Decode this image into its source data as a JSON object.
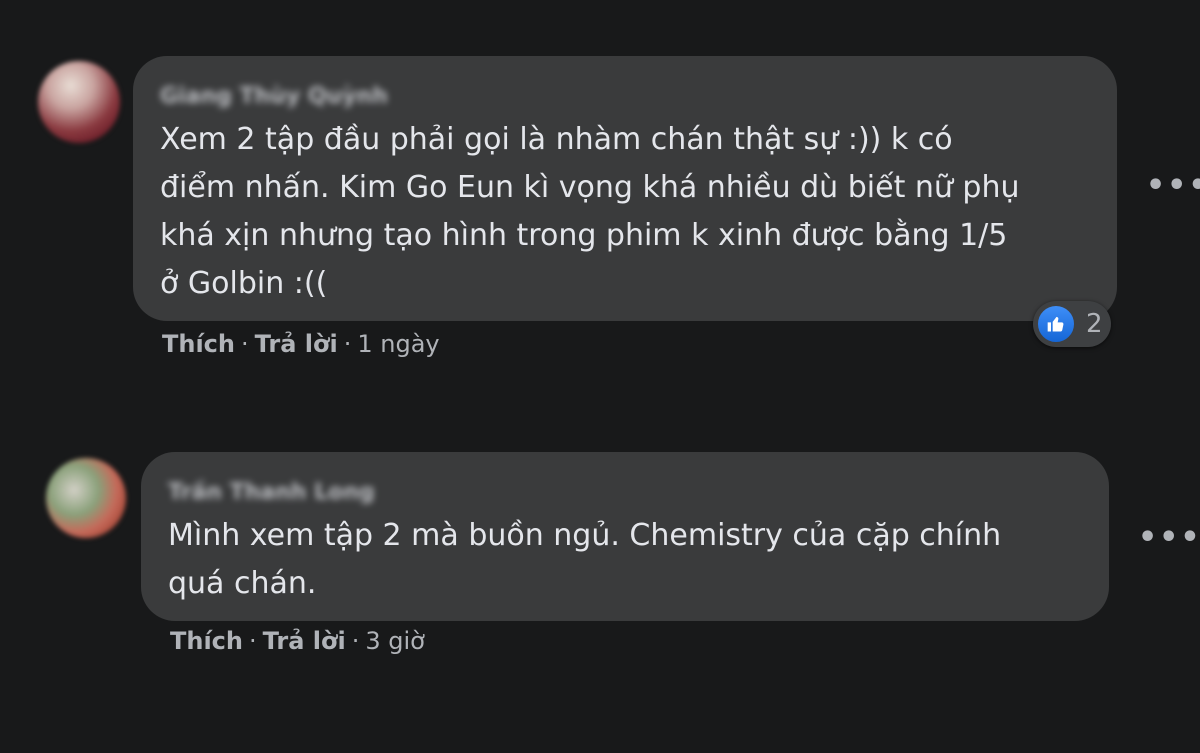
{
  "comments": [
    {
      "author": "Giang Thùy Quỳnh",
      "text": "Xem 2 tập đầu phải gọi là nhàm chán thật sự :)) k có\nđiểm nhấn. Kim Go Eun kì vọng khá nhiều dù biết nữ phụ\nkhá xịn nhưng tạo hình trong phim k xinh được bằng 1/5\nở Golbin :((",
      "like_label": "Thích",
      "reply_label": "Trả lời",
      "time": "1 ngày",
      "reaction_icon": "like-icon",
      "reaction_count": "2",
      "more_label": "•••"
    },
    {
      "author": "Trần Thanh Long",
      "text": "Mình xem tập 2 mà buồn ngủ. Chemistry của cặp chính\nquá chán.",
      "like_label": "Thích",
      "reply_label": "Trả lời",
      "time": "3 giờ",
      "more_label": "•••"
    }
  ],
  "colors": {
    "background": "#18191a",
    "bubble": "#3a3b3c",
    "text": "#e4e6eb",
    "secondary_text": "#b0b3b8",
    "like_blue": "#1877f2"
  }
}
